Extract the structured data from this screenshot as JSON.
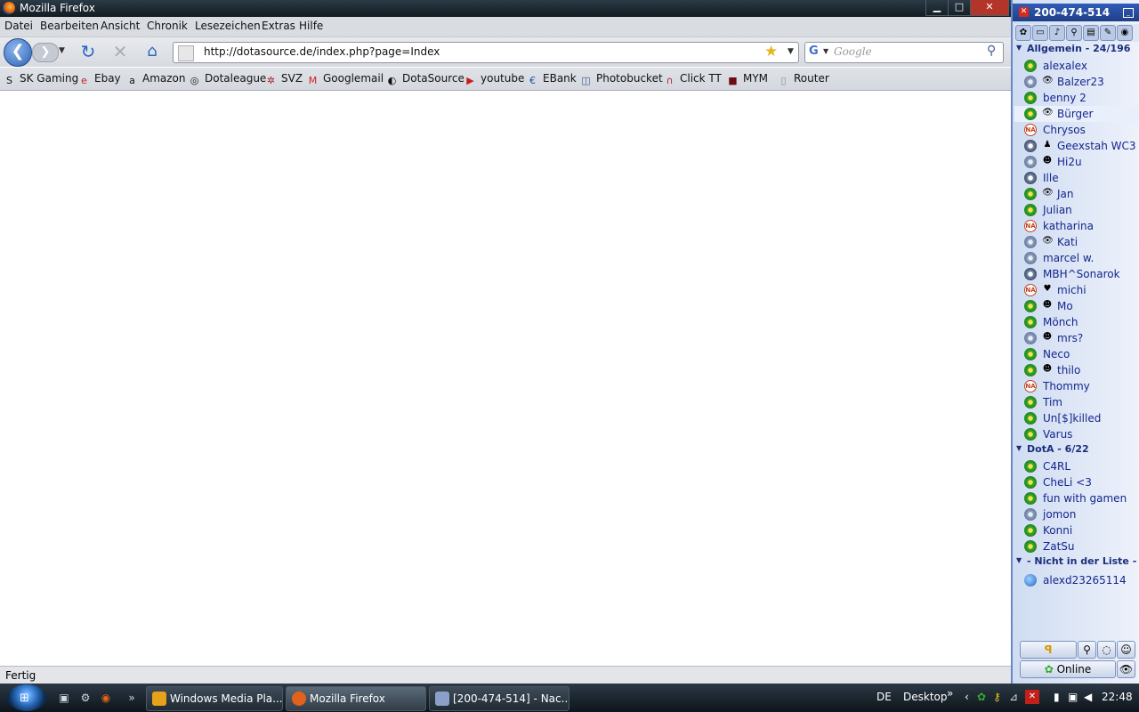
{
  "window": {
    "title": "Mozilla Firefox",
    "buttons": {
      "minimize": "▁",
      "maximize": "□",
      "close": "✕"
    }
  },
  "menu": [
    "Datei",
    "Bearbeiten",
    "Ansicht",
    "Chronik",
    "Lesezeichen",
    "Extras",
    "Hilfe"
  ],
  "nav": {
    "back": "❮",
    "forward": "❯",
    "reload": "↻",
    "stop": "✕",
    "home": "⌂",
    "url": "http://dotasource.de/index.php?page=Index",
    "search_placeholder": "Google",
    "search_engine": "G"
  },
  "bookmarks": [
    {
      "label": "SK Gaming",
      "icon": "sk-icon",
      "glyph": "S"
    },
    {
      "label": "Ebay",
      "icon": "ebay-icon",
      "glyph": "e"
    },
    {
      "label": "Amazon",
      "icon": "amazon-icon",
      "glyph": "a"
    },
    {
      "label": "Dotaleague",
      "icon": "dotaleague-icon",
      "glyph": "◎"
    },
    {
      "label": "SVZ",
      "icon": "svz-icon",
      "glyph": "✲"
    },
    {
      "label": "Googlemail",
      "icon": "gmail-icon",
      "glyph": "M"
    },
    {
      "label": "DotaSource",
      "icon": "dotasource-icon",
      "glyph": "◐"
    },
    {
      "label": "youtube",
      "icon": "youtube-icon",
      "glyph": "▶"
    },
    {
      "label": "EBank",
      "icon": "ebank-icon",
      "glyph": "€"
    },
    {
      "label": "Photobucket",
      "icon": "photobucket-icon",
      "glyph": "◫"
    },
    {
      "label": "Click TT",
      "icon": "clicktt-icon",
      "glyph": "∩"
    },
    {
      "label": "MYM",
      "icon": "mym-icon",
      "glyph": "■"
    },
    {
      "label": "Router",
      "icon": "page-icon",
      "glyph": "▯"
    }
  ],
  "status": "Fertig",
  "icq": {
    "number": "200-474-514",
    "groups": [
      {
        "name": "Allgemein - 24/196",
        "contacts": [
          {
            "name": "alexalex",
            "status": "online",
            "extra": ""
          },
          {
            "name": "Balzer23",
            "status": "offline",
            "extra": "👁"
          },
          {
            "name": "benny 2",
            "status": "online",
            "extra": ""
          },
          {
            "name": "Bürger",
            "status": "online",
            "extra": "👁"
          },
          {
            "name": "Chrysos",
            "status": "na",
            "extra": ""
          },
          {
            "name": "Geexstah WC3",
            "status": "away",
            "extra": "♟"
          },
          {
            "name": "Hi2u",
            "status": "offline",
            "extra": "☻"
          },
          {
            "name": "Ille",
            "status": "away",
            "extra": ""
          },
          {
            "name": "Jan",
            "status": "online",
            "extra": "👁"
          },
          {
            "name": "Julian",
            "status": "online",
            "extra": ""
          },
          {
            "name": "katharina",
            "status": "na",
            "extra": ""
          },
          {
            "name": "Kati",
            "status": "offline",
            "extra": "👁"
          },
          {
            "name": "marcel w.",
            "status": "offline",
            "extra": ""
          },
          {
            "name": "MBH^Sonarok",
            "status": "away",
            "extra": ""
          },
          {
            "name": "michi",
            "status": "na",
            "extra": "♥"
          },
          {
            "name": "Mo",
            "status": "online",
            "extra": "☻"
          },
          {
            "name": "Mönch",
            "status": "online",
            "extra": ""
          },
          {
            "name": "mrs?",
            "status": "offline",
            "extra": "☻"
          },
          {
            "name": "Neco",
            "status": "online",
            "extra": ""
          },
          {
            "name": "thilo",
            "status": "online",
            "extra": "☻"
          },
          {
            "name": "Thommy",
            "status": "na",
            "extra": ""
          },
          {
            "name": "Tim",
            "status": "online",
            "extra": ""
          },
          {
            "name": "Un[$]killed",
            "status": "online",
            "extra": ""
          },
          {
            "name": "Varus",
            "status": "online",
            "extra": ""
          }
        ]
      },
      {
        "name": "DotA - 6/22",
        "contacts": [
          {
            "name": "C4RL",
            "status": "online",
            "extra": ""
          },
          {
            "name": "CheLi <3",
            "status": "online",
            "extra": ""
          },
          {
            "name": "fun with gamen",
            "status": "online",
            "extra": ""
          },
          {
            "name": "jomon",
            "status": "offline",
            "extra": ""
          },
          {
            "name": "Konni",
            "status": "online",
            "extra": ""
          },
          {
            "name": "ZatSu",
            "status": "online",
            "extra": ""
          }
        ]
      },
      {
        "name": "- Nicht in der Liste -",
        "contacts": [
          {
            "name": "alexd23265114",
            "status": "web",
            "extra": ""
          }
        ]
      }
    ],
    "status_button": "Online",
    "logo_button": "ꟼ"
  },
  "taskbar": {
    "tasks": [
      {
        "label": "Windows Media Pla...",
        "icon_color": "#e6a21a"
      },
      {
        "label": "Mozilla Firefox",
        "icon_color": "#e2621b"
      },
      {
        "label": "[200-474-514] - Nac...",
        "icon_color": "#8aa0c8"
      }
    ],
    "lang": "DE",
    "desktop": "Desktop",
    "time": "22:48",
    "more": "»"
  }
}
